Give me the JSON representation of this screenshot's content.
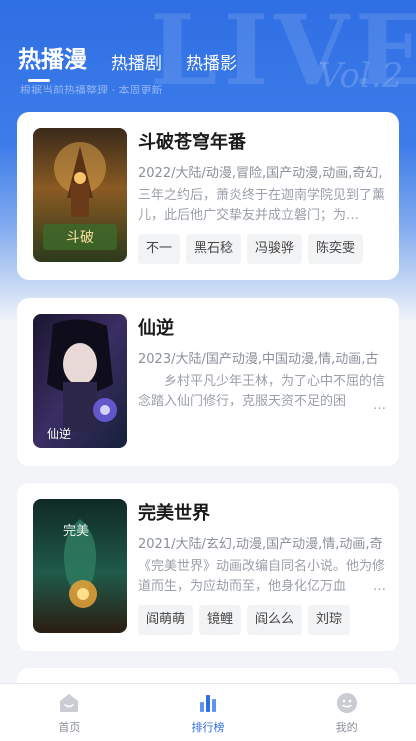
{
  "tabs": [
    {
      "label": "热播漫",
      "active": true
    },
    {
      "label": "热播剧",
      "active": false
    },
    {
      "label": "热播影",
      "active": false
    }
  ],
  "hero_partial_text": "根据当前热播整理 · 本周更新",
  "cards": [
    {
      "title": "斗破苍穹年番",
      "meta": "2022/大陆/动漫,冒险,国产动漫,动画,奇幻,",
      "desc": "三年之约后，萧炎终于在迦南学院见到了薰儿，此后他广交挚友并成立磐门；为…",
      "desc_more": "",
      "tags": [
        "不一",
        "黑石稔",
        "冯骏骅",
        "陈奕雯"
      ]
    },
    {
      "title": "仙逆",
      "meta": "2023/大陆/国产动漫,中国动漫,情,动画,古",
      "desc": "　　乡村平凡少年王林，为了心中不屈的信念踏入仙门修行，克服天资不足的困",
      "desc_more": "…",
      "tags": []
    },
    {
      "title": "完美世界",
      "meta": "2021/大陆/玄幻,动漫,国产动漫,情,动画,奇",
      "desc": "《完美世界》动画改编自同名小说。他为修道而生，为应劫而至，他身化亿万血",
      "desc_more": "…",
      "tags": [
        "阎萌萌",
        "镜鲤",
        "阎么么",
        "刘琮"
      ]
    }
  ],
  "nav": [
    {
      "label": "首页",
      "icon": "home-icon",
      "active": false
    },
    {
      "label": "排行榜",
      "icon": "ranking-icon",
      "active": true
    },
    {
      "label": "我的",
      "icon": "profile-icon",
      "active": false
    }
  ],
  "colors": {
    "accent": "#2f6fe4",
    "inactive": "#8a8f99"
  }
}
